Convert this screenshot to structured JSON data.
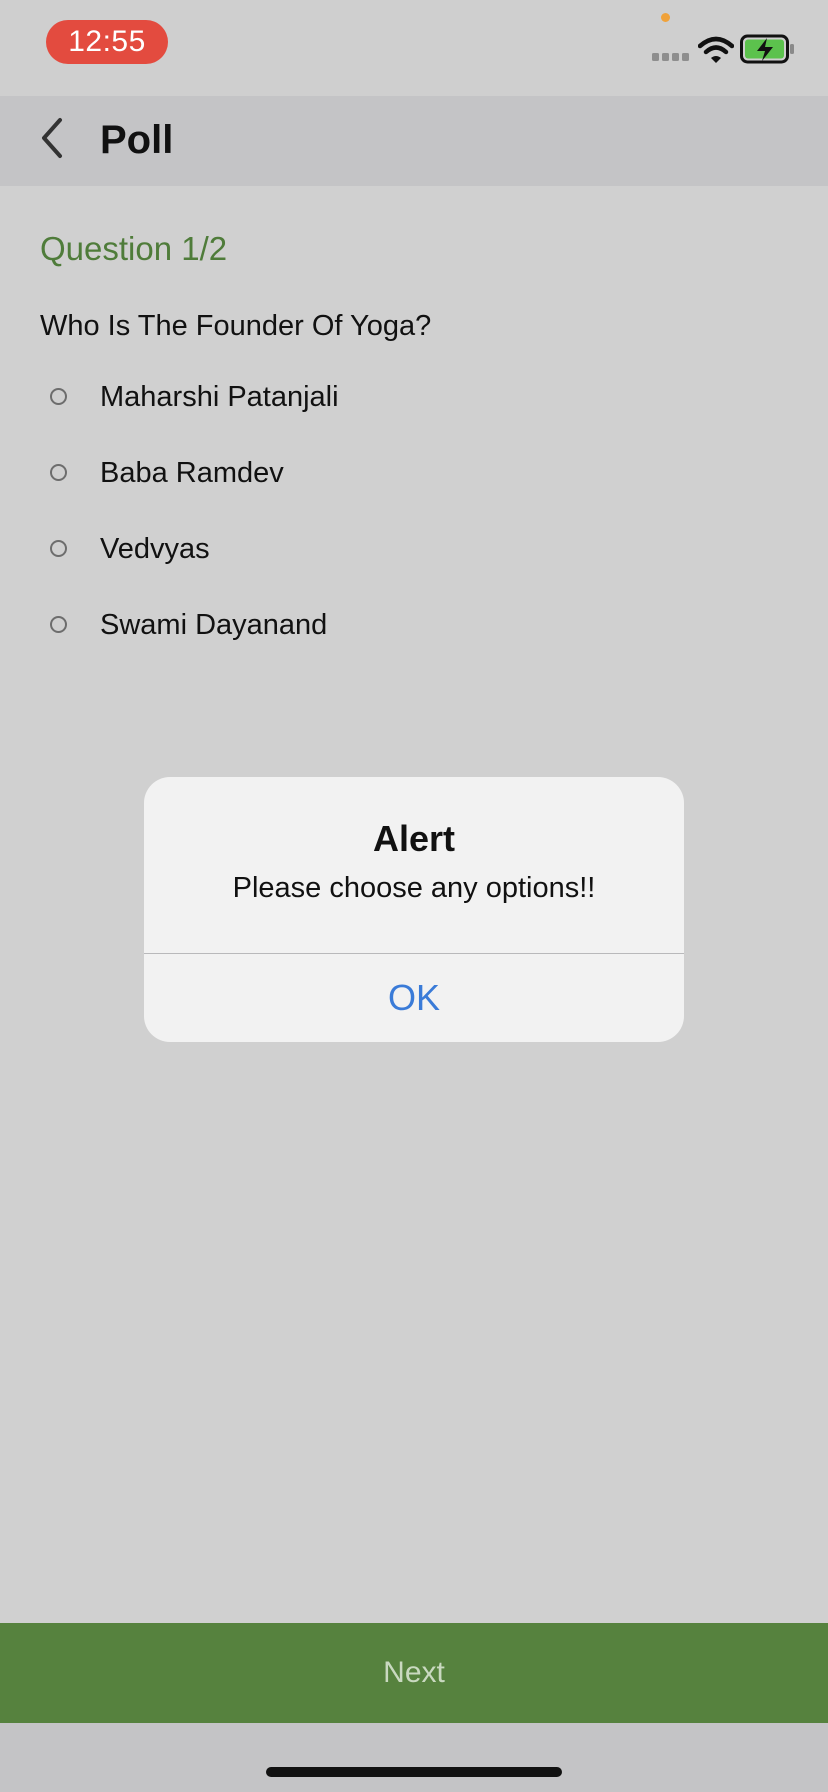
{
  "status_bar": {
    "time": "12:55",
    "icons": [
      "signal-icon",
      "wifi-icon",
      "battery-charging-icon"
    ],
    "time_pill_color": "#e34b3f"
  },
  "nav": {
    "title": "Poll",
    "back_icon": "chevron-left-icon"
  },
  "question": {
    "number_label": "Question 1/2",
    "text": "Who Is The Founder Of Yoga?",
    "options": [
      {
        "label": "Maharshi Patanjali",
        "selected": false
      },
      {
        "label": "Baba Ramdev",
        "selected": false
      },
      {
        "label": "Vedvyas",
        "selected": false
      },
      {
        "label": "Swami Dayanand",
        "selected": false
      }
    ]
  },
  "alert": {
    "title": "Alert",
    "message": "Please choose any options!!",
    "ok_label": "OK"
  },
  "footer": {
    "next_label": "Next"
  },
  "colors": {
    "accent_green": "#56823e",
    "question_green": "#4f7c3a",
    "link_blue": "#3a7bd8"
  }
}
